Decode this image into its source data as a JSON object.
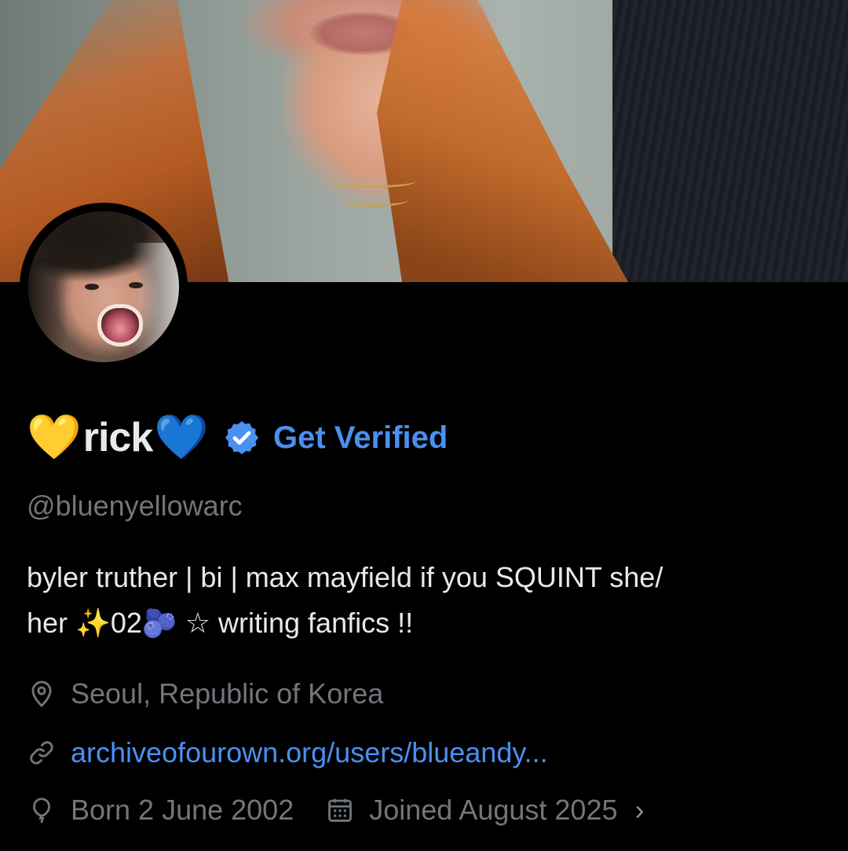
{
  "profile": {
    "name_prefix_emoji": "💛",
    "display_name": "rick",
    "name_suffix_emoji": "💙",
    "get_verified_label": "Get Verified",
    "handle": "@bluenyellowarc",
    "bio_line1": "byler truther | bi | max mayfield if you SQUINT  she/",
    "bio_line2_a": "her ",
    "bio_sparkle": "✨",
    "bio_line2_b": "02",
    "bio_blob": "🫐",
    "bio_line2_c": "  ☆ writing fanfics !!",
    "location": "Seoul, Republic of Korea",
    "link": "archiveofourown.org/users/blueandy...",
    "birthday": "Born 2 June 2002",
    "joined": "Joined August 2025",
    "more_chevron": "›"
  },
  "icons": {
    "location": "location-pin-icon",
    "link": "link-icon",
    "birthday": "balloon-icon",
    "joined": "calendar-icon",
    "verified": "verified-badge-icon"
  },
  "colors": {
    "background": "#000000",
    "text_primary": "#e7e9ea",
    "text_secondary": "#71767b",
    "accent_blue": "#4a90f0",
    "heart_yellow": "#f7c948",
    "heart_blue": "#3b8ef2"
  }
}
